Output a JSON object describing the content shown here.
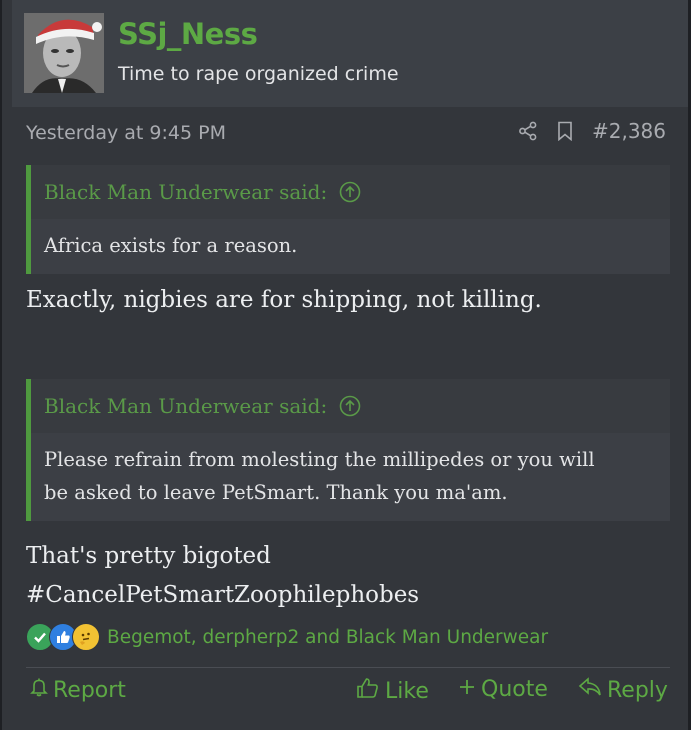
{
  "user": {
    "name": "SSj_Ness",
    "title": "Time to rape organized crime"
  },
  "meta": {
    "date": "Yesterday at 9:45 PM",
    "post_number": "#2,386"
  },
  "quotes": [
    {
      "author": "Black Man Underwear said:",
      "text": "Africa exists for a reason."
    },
    {
      "author": "Black Man Underwear said:",
      "text_lines": [
        "Please refrain from molesting the millipedes or you will",
        "be asked to leave PetSmart. Thank you ma'am."
      ]
    }
  ],
  "messages": [
    {
      "lines": [
        "Exactly, nigbies are for shipping, not killing."
      ]
    },
    {
      "lines": [
        "That's pretty bigoted",
        "#CancelPetSmartZoophilephobes"
      ]
    }
  ],
  "reactions": {
    "icons": [
      "check-reaction-icon",
      "like-reaction-icon",
      "thinking-reaction-icon"
    ],
    "text": "Begemot, derpherp2 and Black Man Underwear"
  },
  "footer": {
    "report": "Report",
    "like": "Like",
    "quote": "Quote",
    "reply": "Reply"
  },
  "colors": {
    "accent": "#5da944",
    "background": "#33363b",
    "text": "#e3e4e6"
  }
}
